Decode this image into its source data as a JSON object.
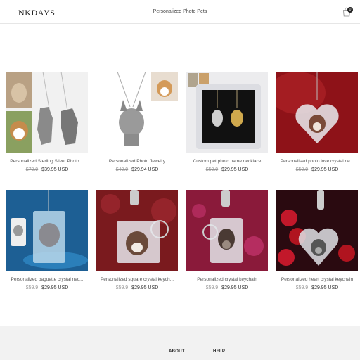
{
  "header": {
    "logo": "NKDAYS",
    "nav_link": "Personalized Photo Pets",
    "cart_count": "0"
  },
  "products": [
    {
      "title": "Personalized Sterling Silver Photo ...",
      "old_price": "$79.9",
      "price": "$39.95 USD",
      "image": "silver-pet-pendant-necklaces"
    },
    {
      "title": "Personalized Photo Jewelry",
      "old_price": "$49.9",
      "price": "$29.94 USD",
      "image": "corgi-pendant-necklace"
    },
    {
      "title": "Custom pet photo name necklace",
      "old_price": "$59.9",
      "price": "$29.95 USD",
      "image": "gold-silver-dog-necklaces-box"
    },
    {
      "title": "Personalised photo love crystal ne...",
      "old_price": "$59.9",
      "price": "$29.95 USD",
      "image": "heart-crystal-dog-red"
    },
    {
      "title": "Personalized baguette crystal nec...",
      "old_price": "$59.9",
      "price": "$29.95 USD",
      "image": "cat-baguette-crystal-blue"
    },
    {
      "title": "Personalized square crystal keych...",
      "old_price": "$59.9",
      "price": "$29.95 USD",
      "image": "dog-square-crystal-keychain"
    },
    {
      "title": "Personalized crystal keychain",
      "old_price": "$59.9",
      "price": "$29.95 USD",
      "image": "dog-crystal-keychain-pink"
    },
    {
      "title": "Personalized heart crystal keychain",
      "old_price": "$59.9",
      "price": "$29.95 USD",
      "image": "heart-crystal-keychain-roses"
    }
  ],
  "footer": {
    "about": "ABOUT",
    "help": "HELP"
  },
  "colors": {
    "footer_bg": "#f2f2f2",
    "text": "#333333",
    "muted": "#999999"
  }
}
